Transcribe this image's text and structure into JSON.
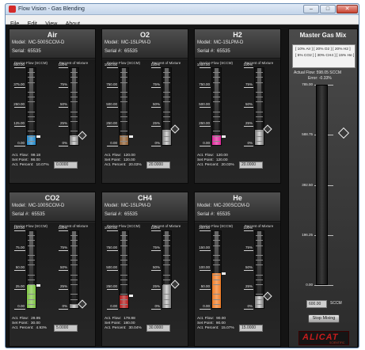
{
  "window": {
    "title": "Flow Vision - Gas Blending",
    "min": "–",
    "max": "□",
    "close": "✕"
  },
  "menu": [
    "File",
    "Edit",
    "View",
    "About"
  ],
  "labels": {
    "model": "Model:",
    "serial": "Serial #:",
    "serial_air": "Serial:",
    "device_flow": "Device Flow (SCCM)",
    "percent_mixture": "Percent of Mixture",
    "act_flow": "Act. Flow:",
    "set_point": "Set Point:",
    "act_percent": "Act. Percent:"
  },
  "percent_ticks": [
    "100%",
    "75%",
    "50%",
    "25%",
    "0%"
  ],
  "gases": [
    {
      "name": "Air",
      "model": "MC-500SCCM-D",
      "serial": "65535",
      "ticks": [
        "500.00",
        "375.00",
        "250.00",
        "125.00",
        "0.00"
      ],
      "fill_color": "#1f86c8",
      "fill_fraction": 0.12,
      "percent_fraction": 0.12,
      "act_flow": "99.18",
      "set_point": "98.00",
      "act_percent": "10.07%",
      "setpoint_value": "0.0000"
    },
    {
      "name": "O2",
      "model": "MC-1SLPM-D",
      "serial": "65535",
      "ticks": [
        "1000.00",
        "750.00",
        "500.00",
        "250.00",
        "0.00"
      ],
      "fill_color": "#8a5a2e",
      "fill_fraction": 0.12,
      "percent_fraction": 0.2,
      "act_flow": "120.00",
      "set_point": "120.00",
      "act_percent": "20.03%",
      "setpoint_value": "20.0000"
    },
    {
      "name": "H2",
      "model": "MC-1SLPM-D",
      "serial": "65535",
      "ticks": [
        "1000.00",
        "750.00",
        "500.00",
        "250.00",
        "0.00"
      ],
      "fill_color": "#e0239a",
      "fill_fraction": 0.12,
      "percent_fraction": 0.2,
      "act_flow": "120.00",
      "set_point": "120.00",
      "act_percent": "20.03%",
      "setpoint_value": "20.0000"
    },
    {
      "name": "CO2",
      "model": "MC-100SCCM-D",
      "serial": "65535",
      "ticks": [
        "100.00",
        "75.00",
        "50.00",
        "25.00",
        "0.00"
      ],
      "fill_color": "#7bc241",
      "fill_fraction": 0.3,
      "percent_fraction": 0.05,
      "act_flow": "29.95",
      "set_point": "30.00",
      "act_percent": "4.93%",
      "setpoint_value": "5.0000"
    },
    {
      "name": "CH4",
      "model": "MC-1SLPM-D",
      "serial": "65535",
      "ticks": [
        "1000.00",
        "750.00",
        "500.00",
        "250.00",
        "0.00"
      ],
      "fill_color": "#b01818",
      "fill_fraction": 0.17,
      "percent_fraction": 0.3,
      "act_flow": "179.88",
      "set_point": "180.00",
      "act_percent": "30.04%",
      "setpoint_value": "30.0000"
    },
    {
      "name": "He",
      "model": "MC-200SCCM-D",
      "serial": "65535",
      "ticks": [
        "200.00",
        "150.00",
        "100.00",
        "50.00",
        "0.00"
      ],
      "fill_color": "#f07a22",
      "fill_fraction": 0.45,
      "percent_fraction": 0.15,
      "act_flow": "90.00",
      "set_point": "90.00",
      "act_percent": "15.07%",
      "setpoint_value": "15.0000"
    }
  ],
  "master": {
    "title": "Master Gas Mix",
    "mix_line1": "[ 10% Air ]  [ 20% O2 ]  [ 20% H2 ]",
    "mix_line2": "[ 5% CO2 ]  [ 30% CH4 ]  [ 15% He ]",
    "actual_flow": "Actual Flow: 598.05 SCCM",
    "error": "Error: -0.33%",
    "ticks": [
      "785.00",
      "588.75",
      "392.50",
      "196.25",
      "0.00"
    ],
    "handle_fraction": 0.76,
    "sccm_value": "600.00",
    "sccm_label": "SCCM",
    "stop_label": "Stop Mixing",
    "logo": "ALICAT",
    "logo_sub": "SCIENTIFIC"
  }
}
